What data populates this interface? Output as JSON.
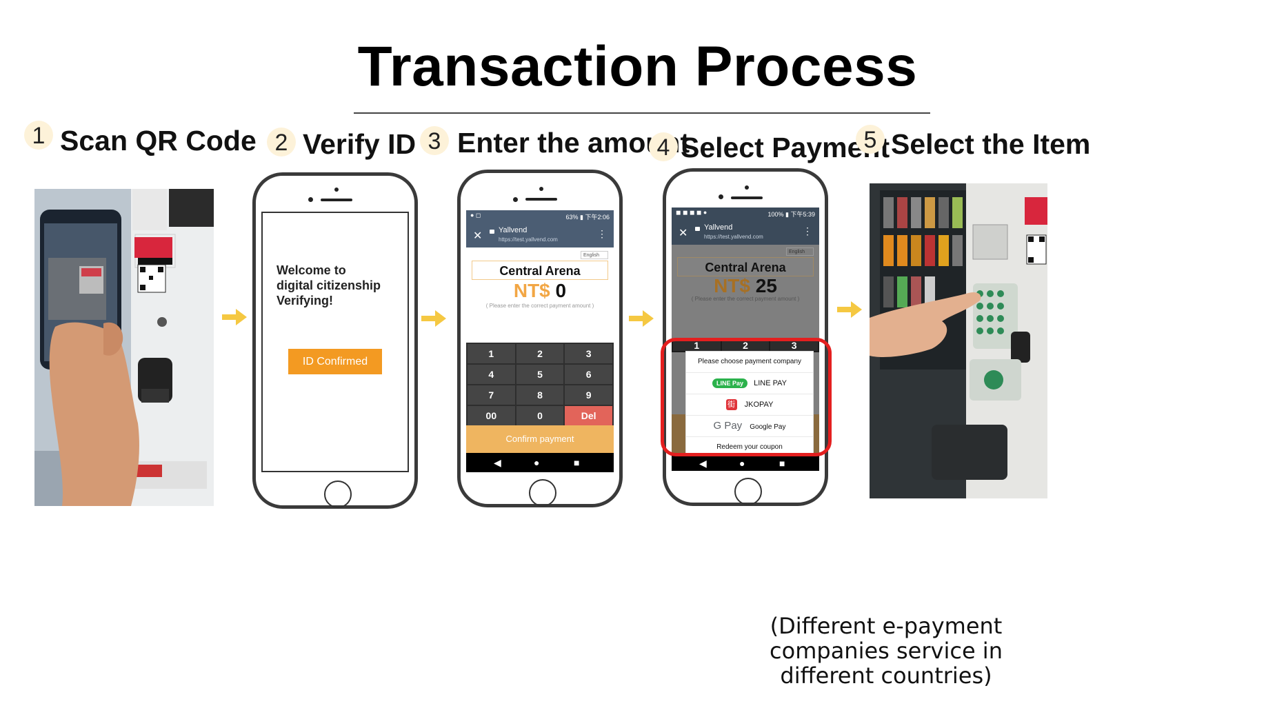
{
  "title": "Transaction Process",
  "steps": [
    {
      "number": "1",
      "label": "Scan QR Code"
    },
    {
      "number": "2",
      "label": "Verify ID"
    },
    {
      "number": "3",
      "label": "Enter the amount"
    },
    {
      "number": "4",
      "label": "Select Payment"
    },
    {
      "number": "5",
      "label": "Select the Item"
    }
  ],
  "phone2": {
    "welcome_lines": [
      "Welcome to",
      "digital citizenship",
      "Verifying!"
    ],
    "button": "ID Confirmed"
  },
  "phone3": {
    "status": "63% ▮ 下午2:06",
    "site": "Yallvend",
    "url": "https://test.yallvend.com",
    "lang": "English",
    "venue": "Central Arena",
    "currency": "NT$",
    "amount": "0",
    "hint": "( Please enter the correct payment amount )",
    "keys": [
      "1",
      "2",
      "3",
      "4",
      "5",
      "6",
      "7",
      "8",
      "9",
      "00",
      "0",
      "Del"
    ],
    "confirm": "Confirm payment"
  },
  "phone4": {
    "status": "100% ▮ 下午5:39",
    "site": "Yallvend",
    "url": "https://test.yallvend.com",
    "lang": "English",
    "venue": "Central Arena",
    "currency": "NT$",
    "amount": "25",
    "hint": "( Please enter the correct payment amount )",
    "keys_visible": [
      "1",
      "2",
      "3"
    ],
    "sheet_title": "Please choose payment company",
    "options": [
      {
        "badge": "LINE Pay",
        "label": "LINE PAY"
      },
      {
        "badge": "街",
        "label": "JKOPAY"
      },
      {
        "badge": "G Pay",
        "label": "Google Pay"
      },
      {
        "badge": "",
        "label": "Redeem your coupon"
      }
    ]
  },
  "footnote": [
    "(Different e-payment",
    "companies service in",
    "different countries)"
  ],
  "colors": {
    "accent_orange": "#f39a22",
    "arrow_yellow": "#f5c842",
    "highlight_red": "#e41f1f",
    "appbar": "#4b5d73"
  }
}
